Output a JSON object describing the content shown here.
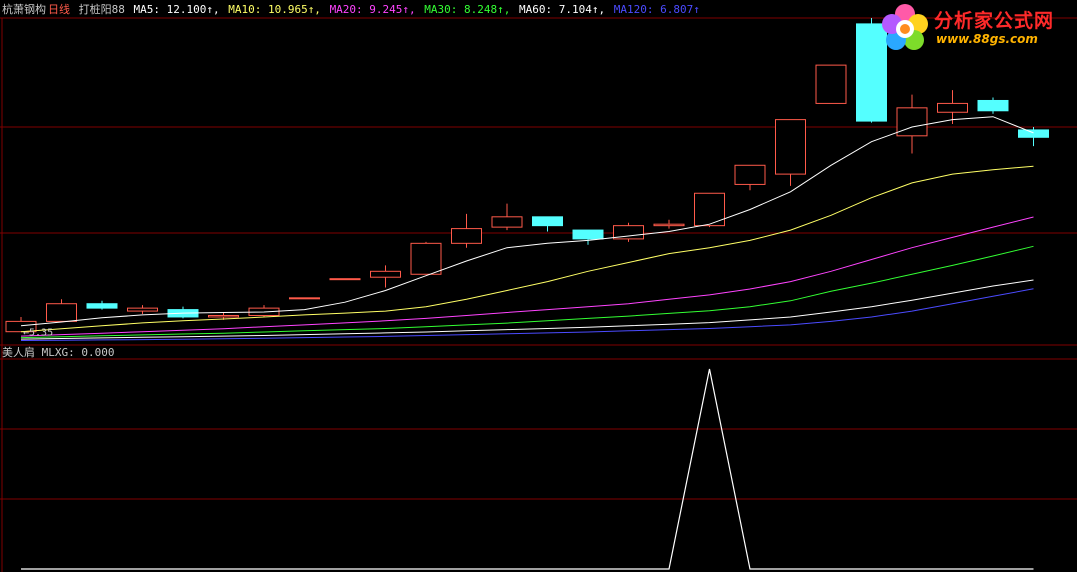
{
  "header": {
    "stock": "杭萧钢构",
    "period": "日线",
    "indicator": "打桩阳88",
    "ma_labels": [
      {
        "text": "MA5: 12.100↑,",
        "color": "#ffffff"
      },
      {
        "text": "MA10: 10.965↑,",
        "color": "#ffff66"
      },
      {
        "text": "MA20: 9.245↑,",
        "color": "#ff44ff"
      },
      {
        "text": "MA30: 8.248↑,",
        "color": "#33ff33"
      },
      {
        "text": "MA60: 7.104↑,",
        "color": "#ffffff"
      },
      {
        "text": "MA120: 6.807↑",
        "color": "#4b4bff"
      }
    ]
  },
  "sub_header": {
    "name": "美人肩",
    "value_text": "MLXG: 0.000"
  },
  "low_marker": "←5.35",
  "logo": {
    "title": "分析家公式网",
    "url": "www.88gs.com"
  },
  "colors": {
    "up": "#ff5a4a",
    "down": "#54ffff",
    "grid": "#800000",
    "ma5": "#ffffff",
    "ma10": "#ffff66",
    "ma20": "#ff44ff",
    "ma30": "#33ff33",
    "ma60": "#ffffff",
    "ma120": "#4b4bff",
    "mlxg": "#ffffff"
  },
  "chart_data": [
    {
      "type": "candlestick",
      "title": "杭萧钢构 日线",
      "ylim": [
        5.0,
        16.0
      ],
      "candles": [
        {
          "o": 5.35,
          "c": 5.7,
          "h": 5.85,
          "l": 5.35
        },
        {
          "o": 5.7,
          "c": 6.3,
          "h": 6.45,
          "l": 5.7
        },
        {
          "o": 6.3,
          "c": 6.15,
          "h": 6.4,
          "l": 6.1
        },
        {
          "o": 6.05,
          "c": 6.15,
          "h": 6.25,
          "l": 5.95
        },
        {
          "o": 6.1,
          "c": 5.85,
          "h": 6.2,
          "l": 5.8
        },
        {
          "o": 5.85,
          "c": 5.9,
          "h": 6.0,
          "l": 5.75
        },
        {
          "o": 5.9,
          "c": 6.15,
          "h": 6.25,
          "l": 5.85
        },
        {
          "o": 6.5,
          "c": 6.5,
          "h": 6.5,
          "l": 6.5
        },
        {
          "o": 7.15,
          "c": 7.15,
          "h": 7.15,
          "l": 7.15
        },
        {
          "o": 7.2,
          "c": 7.4,
          "h": 7.6,
          "l": 6.85
        },
        {
          "o": 7.3,
          "c": 8.35,
          "h": 8.4,
          "l": 7.3
        },
        {
          "o": 8.35,
          "c": 8.85,
          "h": 9.35,
          "l": 8.2
        },
        {
          "o": 8.9,
          "c": 9.25,
          "h": 9.7,
          "l": 8.8
        },
        {
          "o": 9.25,
          "c": 8.95,
          "h": 9.25,
          "l": 8.75
        },
        {
          "o": 8.8,
          "c": 8.5,
          "h": 8.8,
          "l": 8.3
        },
        {
          "o": 8.5,
          "c": 8.95,
          "h": 9.05,
          "l": 8.4
        },
        {
          "o": 8.95,
          "c": 9.0,
          "h": 9.15,
          "l": 8.85
        },
        {
          "o": 8.95,
          "c": 10.05,
          "h": 10.05,
          "l": 8.9
        },
        {
          "o": 10.35,
          "c": 11.0,
          "h": 11.0,
          "l": 10.15
        },
        {
          "o": 10.7,
          "c": 12.55,
          "h": 12.55,
          "l": 10.3
        },
        {
          "o": 13.1,
          "c": 14.4,
          "h": 14.4,
          "l": 13.1
        },
        {
          "o": 15.8,
          "c": 12.5,
          "h": 16.0,
          "l": 12.45
        },
        {
          "o": 12.0,
          "c": 12.95,
          "h": 13.4,
          "l": 11.4
        },
        {
          "o": 12.8,
          "c": 13.1,
          "h": 13.55,
          "l": 12.4
        },
        {
          "o": 13.2,
          "c": 12.85,
          "h": 13.3,
          "l": 12.75
        },
        {
          "o": 12.2,
          "c": 11.95,
          "h": 12.3,
          "l": 11.65
        }
      ],
      "series": [
        {
          "name": "MA5",
          "values": [
            5.55,
            5.68,
            5.82,
            5.92,
            5.98,
            6.0,
            6.02,
            6.1,
            6.35,
            6.75,
            7.25,
            7.75,
            8.2,
            8.35,
            8.45,
            8.6,
            8.75,
            9.0,
            9.5,
            10.1,
            11.0,
            11.8,
            12.3,
            12.55,
            12.65,
            12.1
          ]
        },
        {
          "name": "MA10",
          "values": [
            5.35,
            5.45,
            5.55,
            5.65,
            5.72,
            5.78,
            5.85,
            5.92,
            5.98,
            6.05,
            6.2,
            6.45,
            6.75,
            7.05,
            7.4,
            7.7,
            8.0,
            8.2,
            8.45,
            8.8,
            9.3,
            9.9,
            10.4,
            10.7,
            10.85,
            10.965
          ]
        },
        {
          "name": "MA20",
          "values": [
            5.2,
            5.25,
            5.3,
            5.35,
            5.4,
            5.45,
            5.52,
            5.58,
            5.65,
            5.72,
            5.8,
            5.9,
            6.0,
            6.1,
            6.2,
            6.3,
            6.45,
            6.6,
            6.8,
            7.05,
            7.4,
            7.8,
            8.2,
            8.55,
            8.9,
            9.245
          ]
        },
        {
          "name": "MA30",
          "values": [
            5.15,
            5.18,
            5.21,
            5.24,
            5.27,
            5.3,
            5.34,
            5.38,
            5.42,
            5.46,
            5.52,
            5.58,
            5.64,
            5.72,
            5.8,
            5.88,
            5.97,
            6.06,
            6.2,
            6.4,
            6.72,
            7.0,
            7.3,
            7.6,
            7.92,
            8.248
          ]
        },
        {
          "name": "MA60",
          "values": [
            5.1,
            5.12,
            5.14,
            5.16,
            5.18,
            5.2,
            5.22,
            5.25,
            5.28,
            5.31,
            5.34,
            5.38,
            5.42,
            5.46,
            5.5,
            5.55,
            5.6,
            5.66,
            5.75,
            5.85,
            6.02,
            6.2,
            6.42,
            6.66,
            6.9,
            7.104
          ]
        },
        {
          "name": "MA120",
          "values": [
            5.05,
            5.06,
            5.07,
            5.08,
            5.09,
            5.11,
            5.13,
            5.15,
            5.17,
            5.19,
            5.22,
            5.25,
            5.28,
            5.31,
            5.34,
            5.38,
            5.42,
            5.46,
            5.52,
            5.58,
            5.7,
            5.85,
            6.05,
            6.3,
            6.55,
            6.807
          ]
        }
      ]
    },
    {
      "type": "line",
      "title": "美人肩",
      "series": [
        {
          "name": "MLXG",
          "values": [
            0,
            0,
            0,
            0,
            0,
            0,
            0,
            0,
            0,
            0,
            0,
            0,
            0,
            0,
            0,
            0,
            0,
            0,
            0,
            0,
            0,
            0,
            0,
            0,
            0,
            0
          ]
        }
      ],
      "spike": {
        "from": 16,
        "peak": 17,
        "to": 18,
        "value": 1
      },
      "ylim": [
        0,
        1.05
      ]
    }
  ]
}
